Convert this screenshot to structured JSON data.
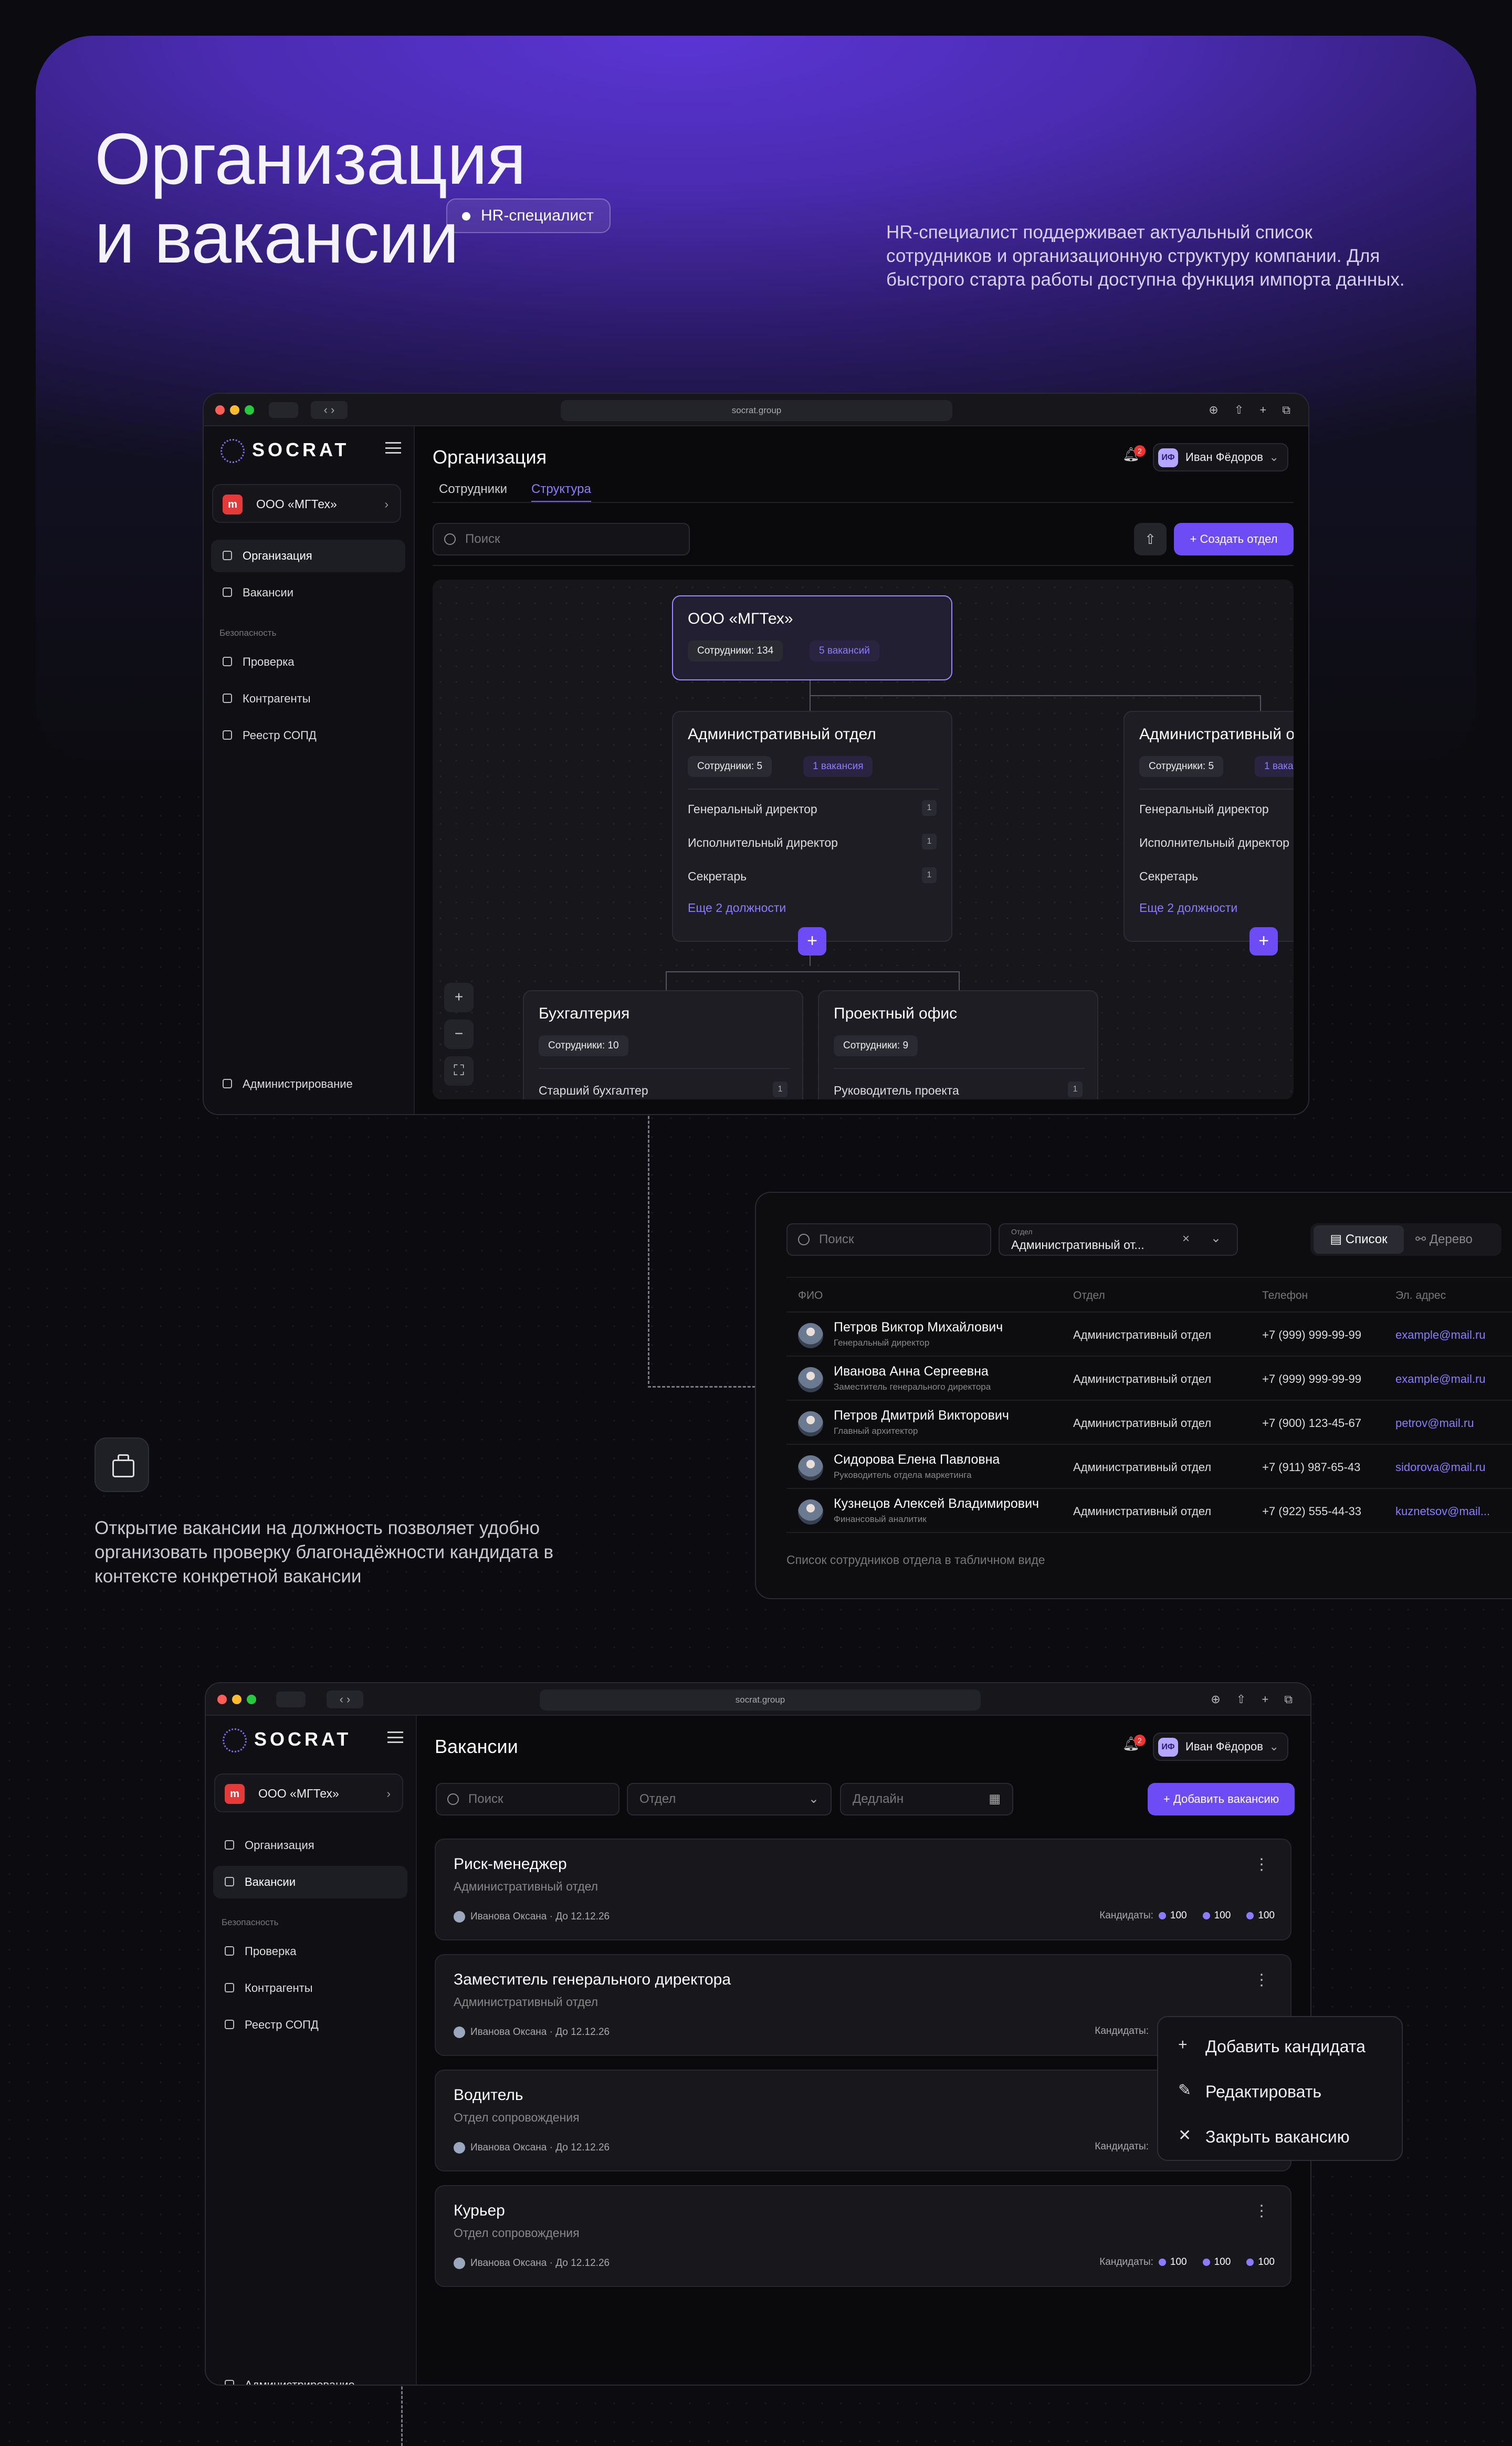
{
  "hero": {
    "title_line1": "Организация",
    "title_line2": "и вакансии",
    "pill": "HR-специалист",
    "description": "HR-специалист поддерживает актуальный список сотрудников и организационную структуру компании. Для быстрого старта работы доступна функция импорта данных."
  },
  "browser": {
    "url": "socrat.group"
  },
  "sidebar": {
    "logo": "SOCRAT",
    "org_badge": "m",
    "org_name": "ООО «МГТех»",
    "nav_org": "Организация",
    "nav_vac": "Вакансии",
    "section_security": "Безопасность",
    "nav_check": "Проверка",
    "nav_contr": "Контрагенты",
    "nav_registry": "Реестр СОПД",
    "nav_admin": "Администрирование"
  },
  "org_screen": {
    "title": "Организация",
    "tab_employees": "Сотрудники",
    "tab_structure": "Структура",
    "search_placeholder": "Поиск",
    "create_button": "+ Создать отдел",
    "notif_count": "2",
    "user_initials": "ИФ",
    "user_name": "Иван Фёдоров",
    "root": {
      "name": "ООО «МГТех»",
      "employees": "Сотрудники: 134",
      "vacancies": "5 вакансий"
    },
    "dept_a": {
      "name": "Административный отдел",
      "employees": "Сотрудники: 5",
      "vacancies": "1 вакансия",
      "roles": [
        {
          "name": "Генеральный директор",
          "count": "1"
        },
        {
          "name": "Исполнительный директор",
          "count": "1"
        },
        {
          "name": "Секретарь",
          "count": "1"
        }
      ],
      "more": "Еще 2 должности"
    },
    "dept_b": {
      "name": "Административный о",
      "employees": "Сотрудники: 5",
      "vacancies": "1 ваканс",
      "roles": [
        "Генеральный директор",
        "Исполнительный директор",
        "Секретарь"
      ],
      "more": "Еще 2 должности"
    },
    "dept_c": {
      "name": "Бухгалтерия",
      "employees": "Сотрудники: 10",
      "role": "Старший бухгалтер",
      "count": "1"
    },
    "dept_d": {
      "name": "Проектный офис",
      "employees": "Сотрудники: 9",
      "role": "Руководитель проекта",
      "count": "1"
    }
  },
  "list_panel": {
    "search_placeholder": "Поиск",
    "filter_label": "Отдел",
    "filter_value": "Административный от...",
    "view_list": "Список",
    "view_tree": "Дерево",
    "headers": [
      "ФИО",
      "Отдел",
      "Телефон",
      "Эл. адрес"
    ],
    "rows": [
      {
        "name": "Петров Виктор Михайлович",
        "role": "Генеральный директор",
        "dept": "Административный отдел",
        "phone": "+7 (999) 999-99-99",
        "email": "example@mail.ru"
      },
      {
        "name": "Иванова Анна Сергеевна",
        "role": "Заместитель генерального директора",
        "dept": "Административный отдел",
        "phone": "+7 (999) 999-99-99",
        "email": "example@mail.ru"
      },
      {
        "name": "Петров Дмитрий Викторович",
        "role": "Главный архитектор",
        "dept": "Административный отдел",
        "phone": "+7 (900) 123-45-67",
        "email": "petrov@mail.ru"
      },
      {
        "name": "Сидорова Елена Павловна",
        "role": "Руководитель отдела маркетинга",
        "dept": "Административный отдел",
        "phone": "+7 (911) 987-65-43",
        "email": "sidorova@mail.ru"
      },
      {
        "name": "Кузнецов Алексей Владимирович",
        "role": "Финансовый аналитик",
        "dept": "Административный отдел",
        "phone": "+7 (922) 555-44-33",
        "email": "kuznetsov@mail..."
      }
    ],
    "caption": "Список сотрудников отдела в табличном виде"
  },
  "vac_text": "Открытие вакансии на должность позволяет удобно организовать проверку благонадёжности кандидата в контексте конкретной вакансии",
  "vac_screen": {
    "title": "Вакансии",
    "search_placeholder": "Поиск",
    "dept_placeholder": "Отдел",
    "deadline_placeholder": "Дедлайн",
    "add_button": "+ Добавить вакансию",
    "candidates_label": "Кандидаты:",
    "cards": [
      {
        "title": "Риск-менеджер",
        "dept": "Административный отдел",
        "meta": "Иванова Оксана  ·  До 12.12.26",
        "c1": "100",
        "c2": "100",
        "c3": "100"
      },
      {
        "title": "Заместитель генерального директора",
        "dept": "Административный отдел",
        "meta": "Иванова Оксана  ·  До 12.12.26"
      },
      {
        "title": "Водитель",
        "dept": "Отдел сопровождения",
        "meta": "Иванова Оксана  ·  До 12.12.26"
      },
      {
        "title": "Курьер",
        "dept": "Отдел сопровождения",
        "meta": "Иванова Оксана  ·  До 12.12.26",
        "c1": "100",
        "c2": "100",
        "c3": "100"
      }
    ],
    "menu": [
      "Добавить кандидата",
      "Редактировать",
      "Закрыть вакансию"
    ]
  }
}
